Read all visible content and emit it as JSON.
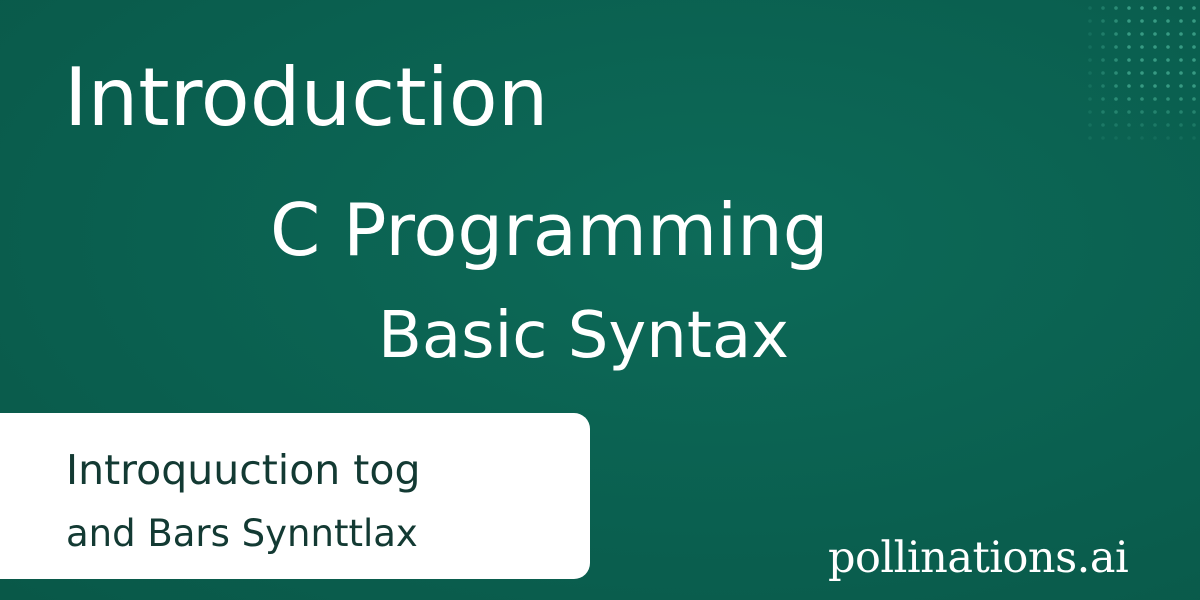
{
  "slide": {
    "title_top": "Introduction",
    "title_main": "C Programming",
    "title_sub": "Basic Syntax"
  },
  "caption": {
    "line1": "Introquuction tog",
    "line2": "and Bars Synnttlax"
  },
  "watermark": {
    "text": "pollinations.ai"
  },
  "colors": {
    "background": "#0b6151",
    "text_light": "#ffffff",
    "card_background": "#ffffff",
    "card_text": "#133a33",
    "dot_accent": "#3fa58c"
  },
  "decor": {
    "dot_pattern_icon": "dot-grid-icon"
  }
}
